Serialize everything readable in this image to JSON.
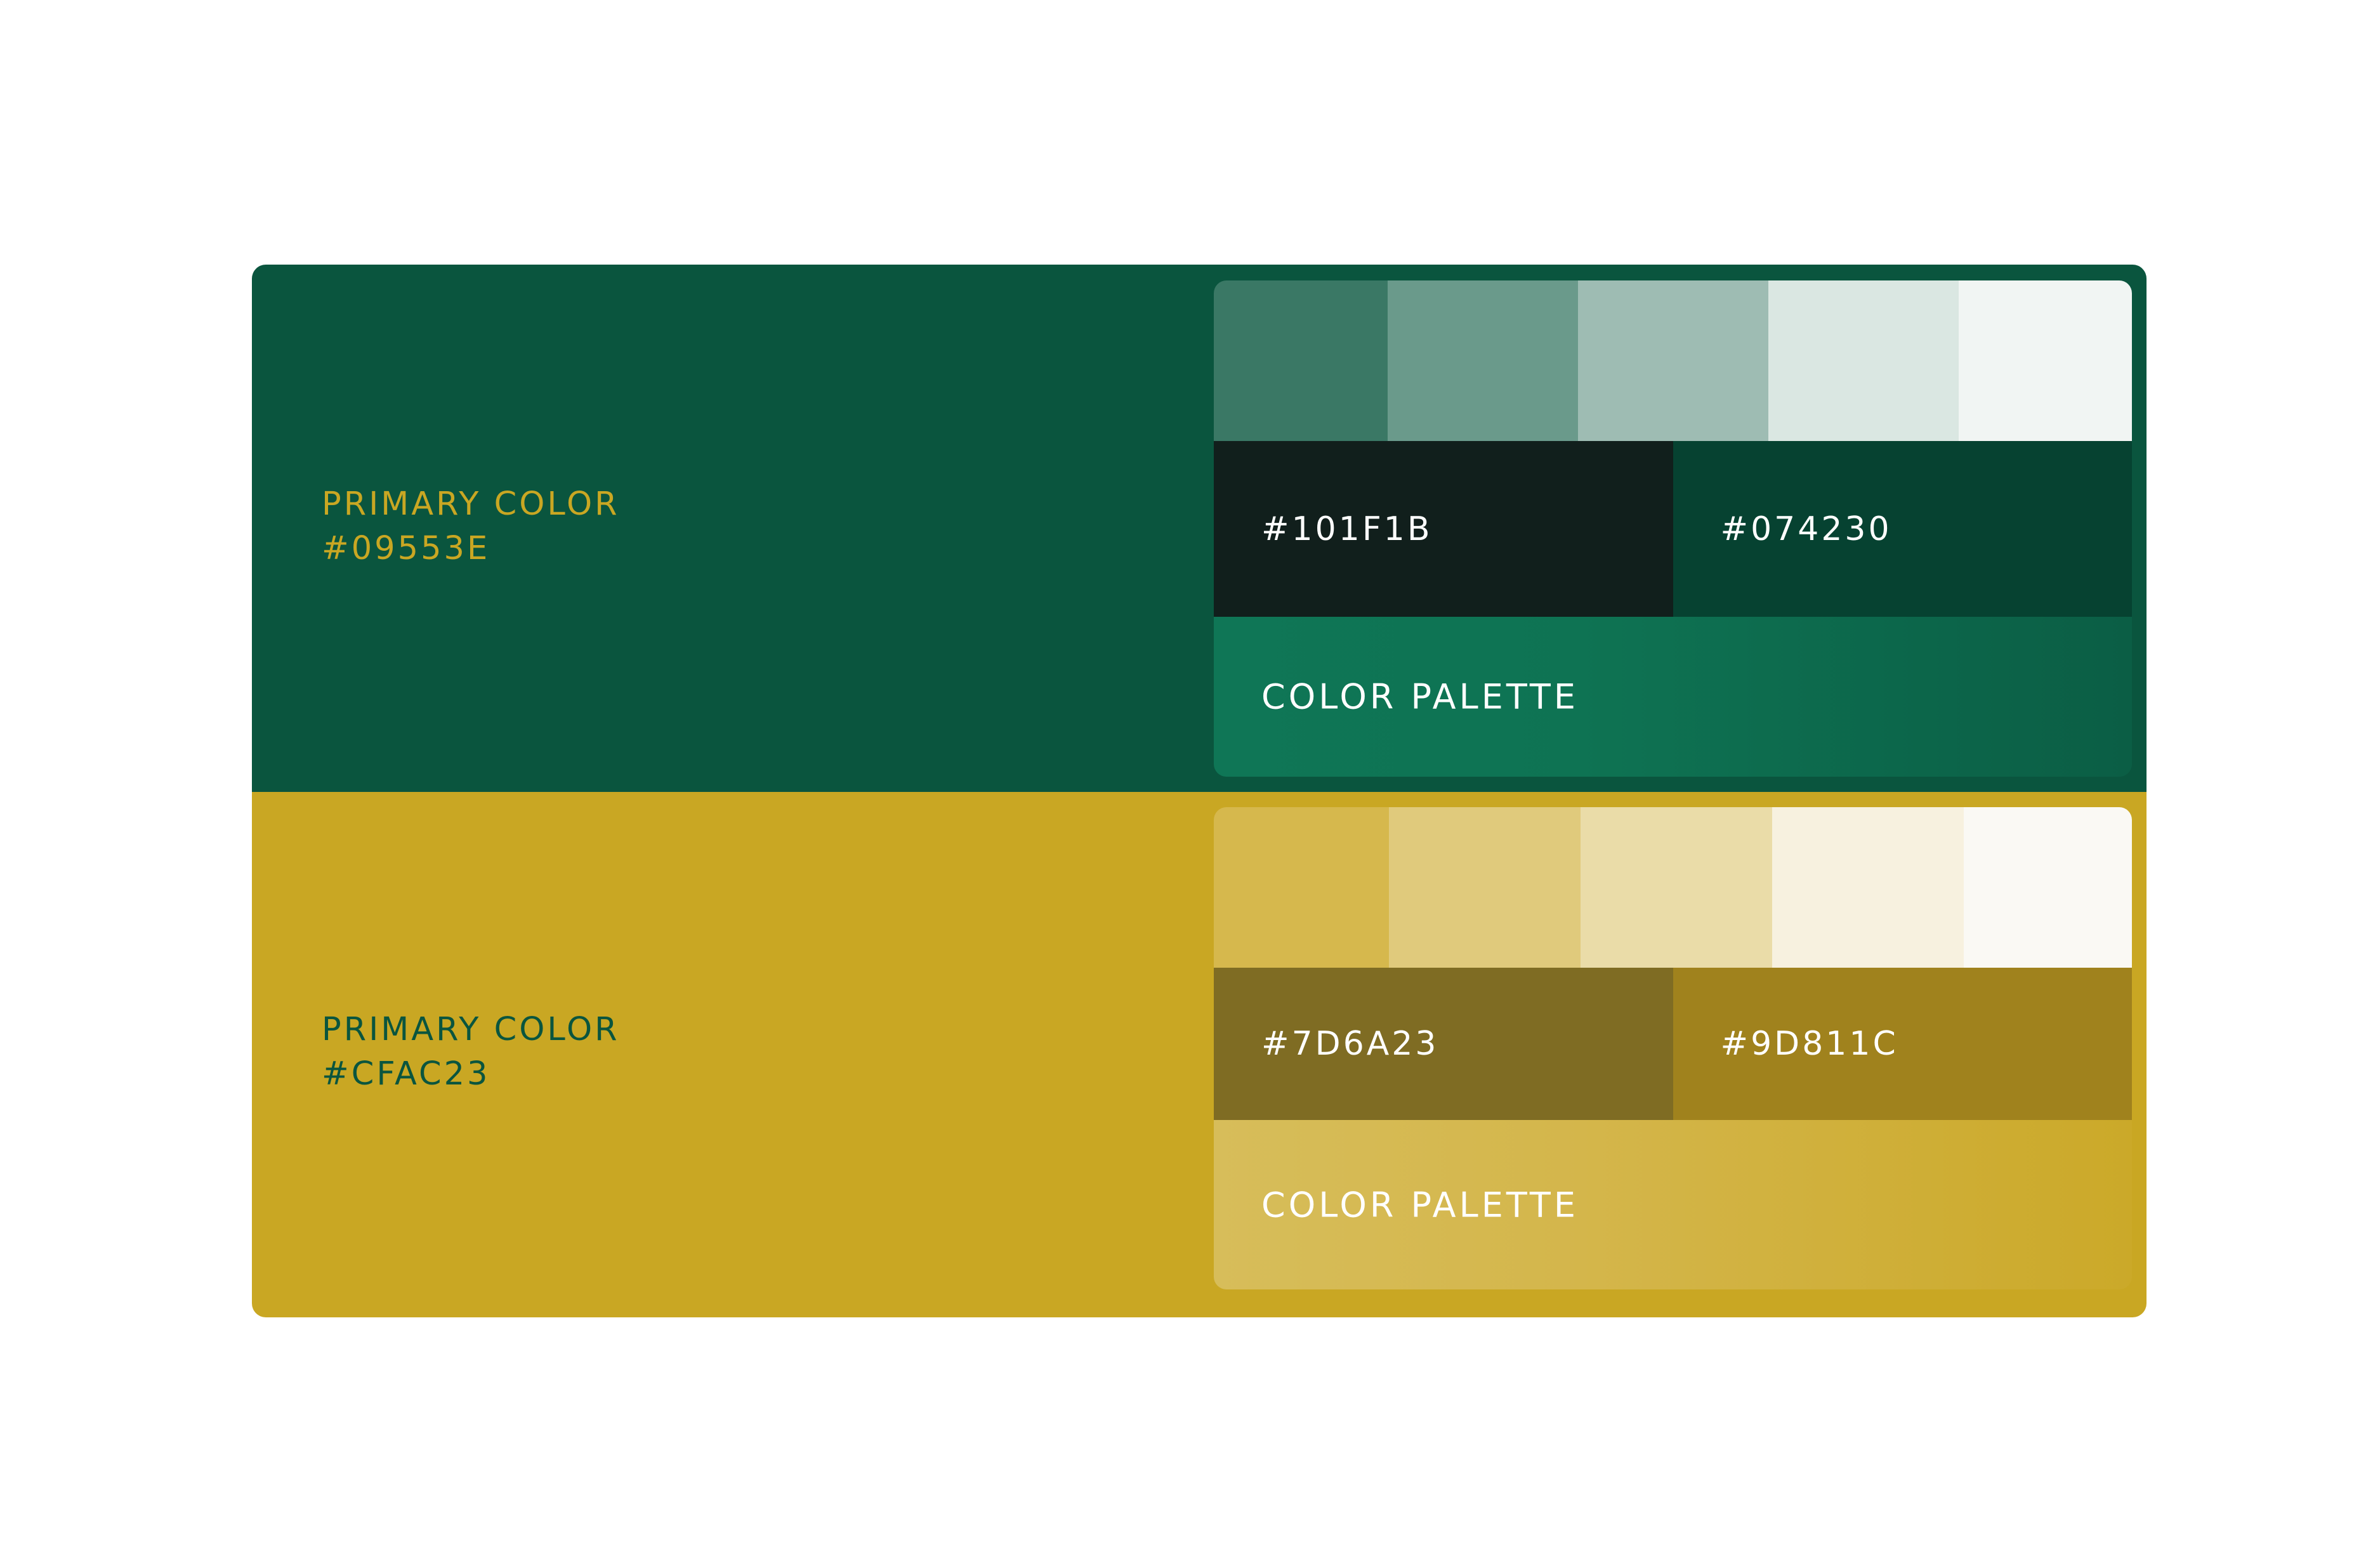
{
  "colors": {
    "green_band": "#0A553E",
    "gold_band": "#C9A723"
  },
  "primaries": [
    {
      "label": "PRIMARY COLOR",
      "hex": "#09553E",
      "text_color": "#C9A723",
      "tints": [
        "#3A7865",
        "#6A9A8B",
        "#9EBCB3",
        "#DAE7E2",
        "#F1F5F3"
      ],
      "shades": [
        {
          "hex": "#101F1B",
          "color": "#111F1C"
        },
        {
          "hex": "#074230",
          "color": "#064231"
        }
      ],
      "palette_label": "COLOR PALETTE"
    },
    {
      "label": "PRIMARY COLOR",
      "hex": "#CFAC23",
      "text_color": "#0A553E",
      "tints": [
        "#D6B84D",
        "#E0CA7C",
        "#EADCA8",
        "#F7F1DF",
        "#FAF9F4"
      ],
      "shades": [
        {
          "hex": "#7D6A23",
          "color": "#7F6C23"
        },
        {
          "hex": "#9D811C",
          "color": "#A0821D"
        }
      ],
      "palette_label": "COLOR PALETTE"
    }
  ]
}
